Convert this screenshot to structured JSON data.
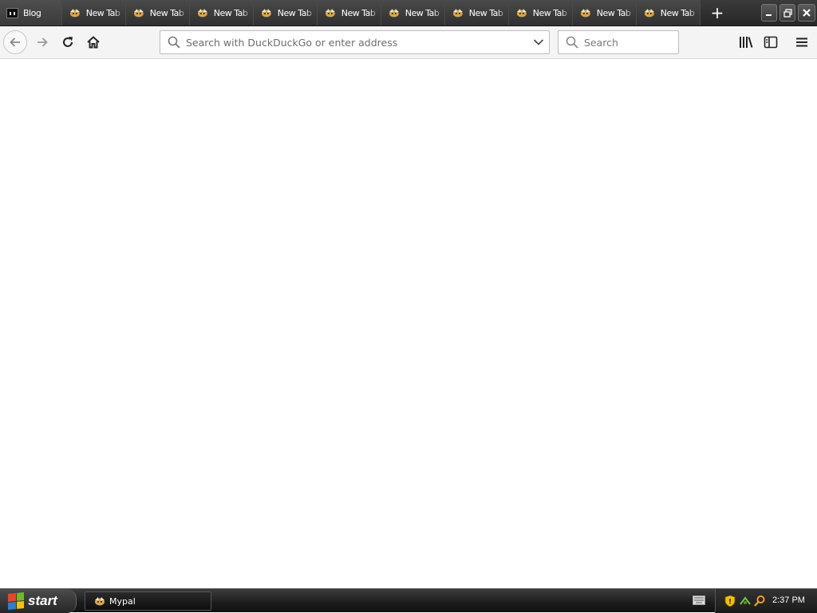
{
  "browser": {
    "tabs": [
      {
        "label": "Blog",
        "favicon": "blog-icon",
        "active": true
      },
      {
        "label": "New Tab",
        "favicon": "mypal-icon"
      },
      {
        "label": "New Tab",
        "favicon": "mypal-icon"
      },
      {
        "label": "New Tab",
        "favicon": "mypal-icon"
      },
      {
        "label": "New Tab",
        "favicon": "mypal-icon"
      },
      {
        "label": "New Tab",
        "favicon": "mypal-icon"
      },
      {
        "label": "New Tab",
        "favicon": "mypal-icon"
      },
      {
        "label": "New Tab",
        "favicon": "mypal-icon"
      },
      {
        "label": "New Tab",
        "favicon": "mypal-icon"
      },
      {
        "label": "New Tab",
        "favicon": "mypal-icon"
      },
      {
        "label": "New Tab",
        "favicon": "mypal-icon"
      }
    ],
    "new_tab_icon": "plus-icon",
    "window_controls": {
      "minimize": "minimize-icon",
      "maximize": "restore-icon",
      "close": "close-icon"
    },
    "nav": {
      "back_icon": "arrow-left-icon",
      "forward_icon": "arrow-right-icon",
      "reload_icon": "reload-icon",
      "home_icon": "home-icon"
    },
    "urlbar": {
      "placeholder": "Search with DuckDuckGo or enter address",
      "value": ""
    },
    "searchbar": {
      "placeholder": "Search",
      "value": ""
    },
    "toolbar": {
      "library_icon": "library-icon",
      "sidebar_icon": "sidebar-icon",
      "menu_icon": "hamburger-menu-icon"
    }
  },
  "taskbar": {
    "start_label": "start",
    "task_items": [
      {
        "label": "Mypal",
        "icon": "mypal-icon"
      }
    ],
    "clock": "2:37 PM"
  },
  "colors": {
    "tabstrip": "#2e2e2e",
    "navbar": "#f4f4f4",
    "content": "#ffffff",
    "taskbar": "#1c1c1c"
  }
}
